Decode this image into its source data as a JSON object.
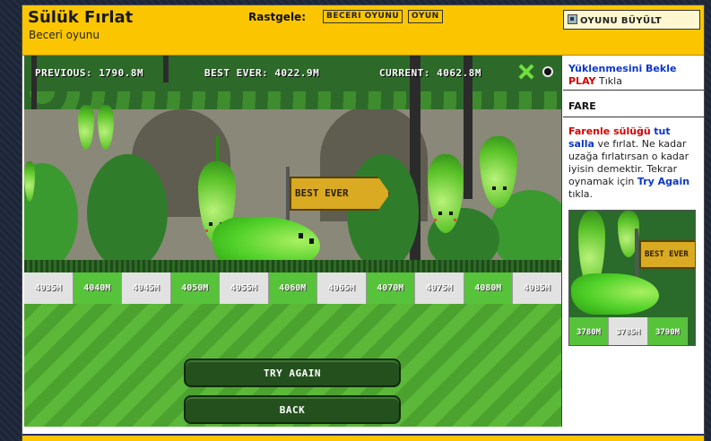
{
  "header": {
    "title": "Sülük Fırlat",
    "subtitle": "Beceri oyunu",
    "random_label": "Rastgele:",
    "tags": [
      "BECERI OYUNU",
      "OYUN"
    ],
    "enlarge_label": "OYUNU BÜYÜLT"
  },
  "game": {
    "hud": {
      "previous": "PREVIOUS: 1790.8M",
      "best_ever": "BEST EVER: 4022.9M",
      "current": "CURRENT: 4062.8M"
    },
    "flag_label": "BEST EVER",
    "ruler": [
      "4035M",
      "4040M",
      "4045M",
      "4050M",
      "4055M",
      "4060M",
      "4065M",
      "4070M",
      "4075M",
      "4080M",
      "4085M"
    ],
    "buttons": {
      "try_again": "TRY AGAIN",
      "back": "BACK"
    }
  },
  "sidebar": {
    "loading": "Yüklenmesini Bekle",
    "play": "PLAY",
    "play_suffix": "Tıkla",
    "heading": "FARE",
    "instr_red": "Farenle sülüğü",
    "instr_blue1": "tut salla",
    "instr_mid": "ve fırlat. Ne kadar uzağa fırlatırsan o kadar iyisin demektir. Tekrar oynamak için",
    "instr_blue2": "Try Again",
    "instr_end": "tıkla.",
    "thumb_flag": "BEST EVER",
    "thumb_ruler": [
      "3780M",
      "3785M",
      "3790M"
    ]
  },
  "colors": {
    "header": "#fbc600",
    "ruler_green": "#56c33a",
    "ruler_gray": "#e2e2e2",
    "button": "#24501e"
  }
}
